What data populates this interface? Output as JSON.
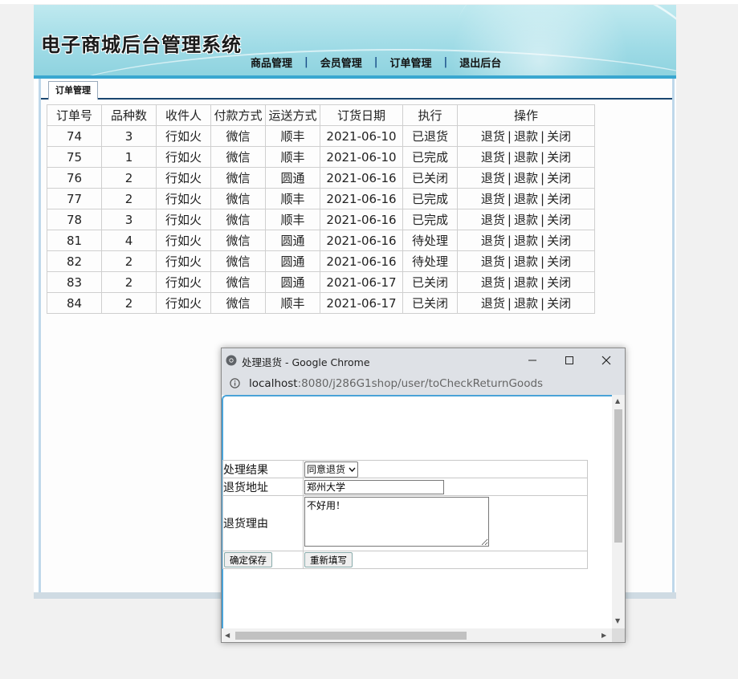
{
  "app": {
    "title": "电子商城后台管理系统",
    "nav": [
      {
        "label": "商品管理"
      },
      {
        "label": "会员管理"
      },
      {
        "label": "订单管理"
      },
      {
        "label": "退出后台"
      }
    ],
    "nav_sep": "|",
    "tab": "订单管理"
  },
  "orders": {
    "headers": [
      "订单号",
      "品种数",
      "收件人",
      "付款方式",
      "运送方式",
      "订货日期",
      "执行",
      "操作"
    ],
    "rows": [
      [
        "74",
        "3",
        "行如火",
        "微信",
        "顺丰",
        "2021-06-10",
        "已退货"
      ],
      [
        "75",
        "1",
        "行如火",
        "微信",
        "顺丰",
        "2021-06-10",
        "已完成"
      ],
      [
        "76",
        "2",
        "行如火",
        "微信",
        "圆通",
        "2021-06-16",
        "已关闭"
      ],
      [
        "77",
        "2",
        "行如火",
        "微信",
        "顺丰",
        "2021-06-16",
        "已完成"
      ],
      [
        "78",
        "3",
        "行如火",
        "微信",
        "顺丰",
        "2021-06-16",
        "已完成"
      ],
      [
        "81",
        "4",
        "行如火",
        "微信",
        "圆通",
        "2021-06-16",
        "待处理"
      ],
      [
        "82",
        "2",
        "行如火",
        "微信",
        "圆通",
        "2021-06-16",
        "待处理"
      ],
      [
        "83",
        "2",
        "行如火",
        "微信",
        "圆通",
        "2021-06-17",
        "已关闭"
      ],
      [
        "84",
        "2",
        "行如火",
        "微信",
        "顺丰",
        "2021-06-17",
        "已关闭"
      ]
    ],
    "actions": [
      "退货",
      "退款",
      "关闭"
    ],
    "action_sep": "|"
  },
  "popup": {
    "window_title": "处理退货 - Google Chrome",
    "url_host": "localhost",
    "url_rest": ":8080/j286G1shop/user/toCheckReturnGoods",
    "form": {
      "result_label": "处理结果",
      "result_value": "同意退货",
      "address_label": "退货地址",
      "address_value": "郑州大学",
      "reason_label": "退货理由",
      "reason_value": "不好用！",
      "save_button": "确定保存",
      "reset_button": "重新填写"
    }
  },
  "colors": {
    "banner": "#9fdbe6",
    "accent_blue": "#3aa7d0",
    "tab_border": "#1b4770"
  }
}
